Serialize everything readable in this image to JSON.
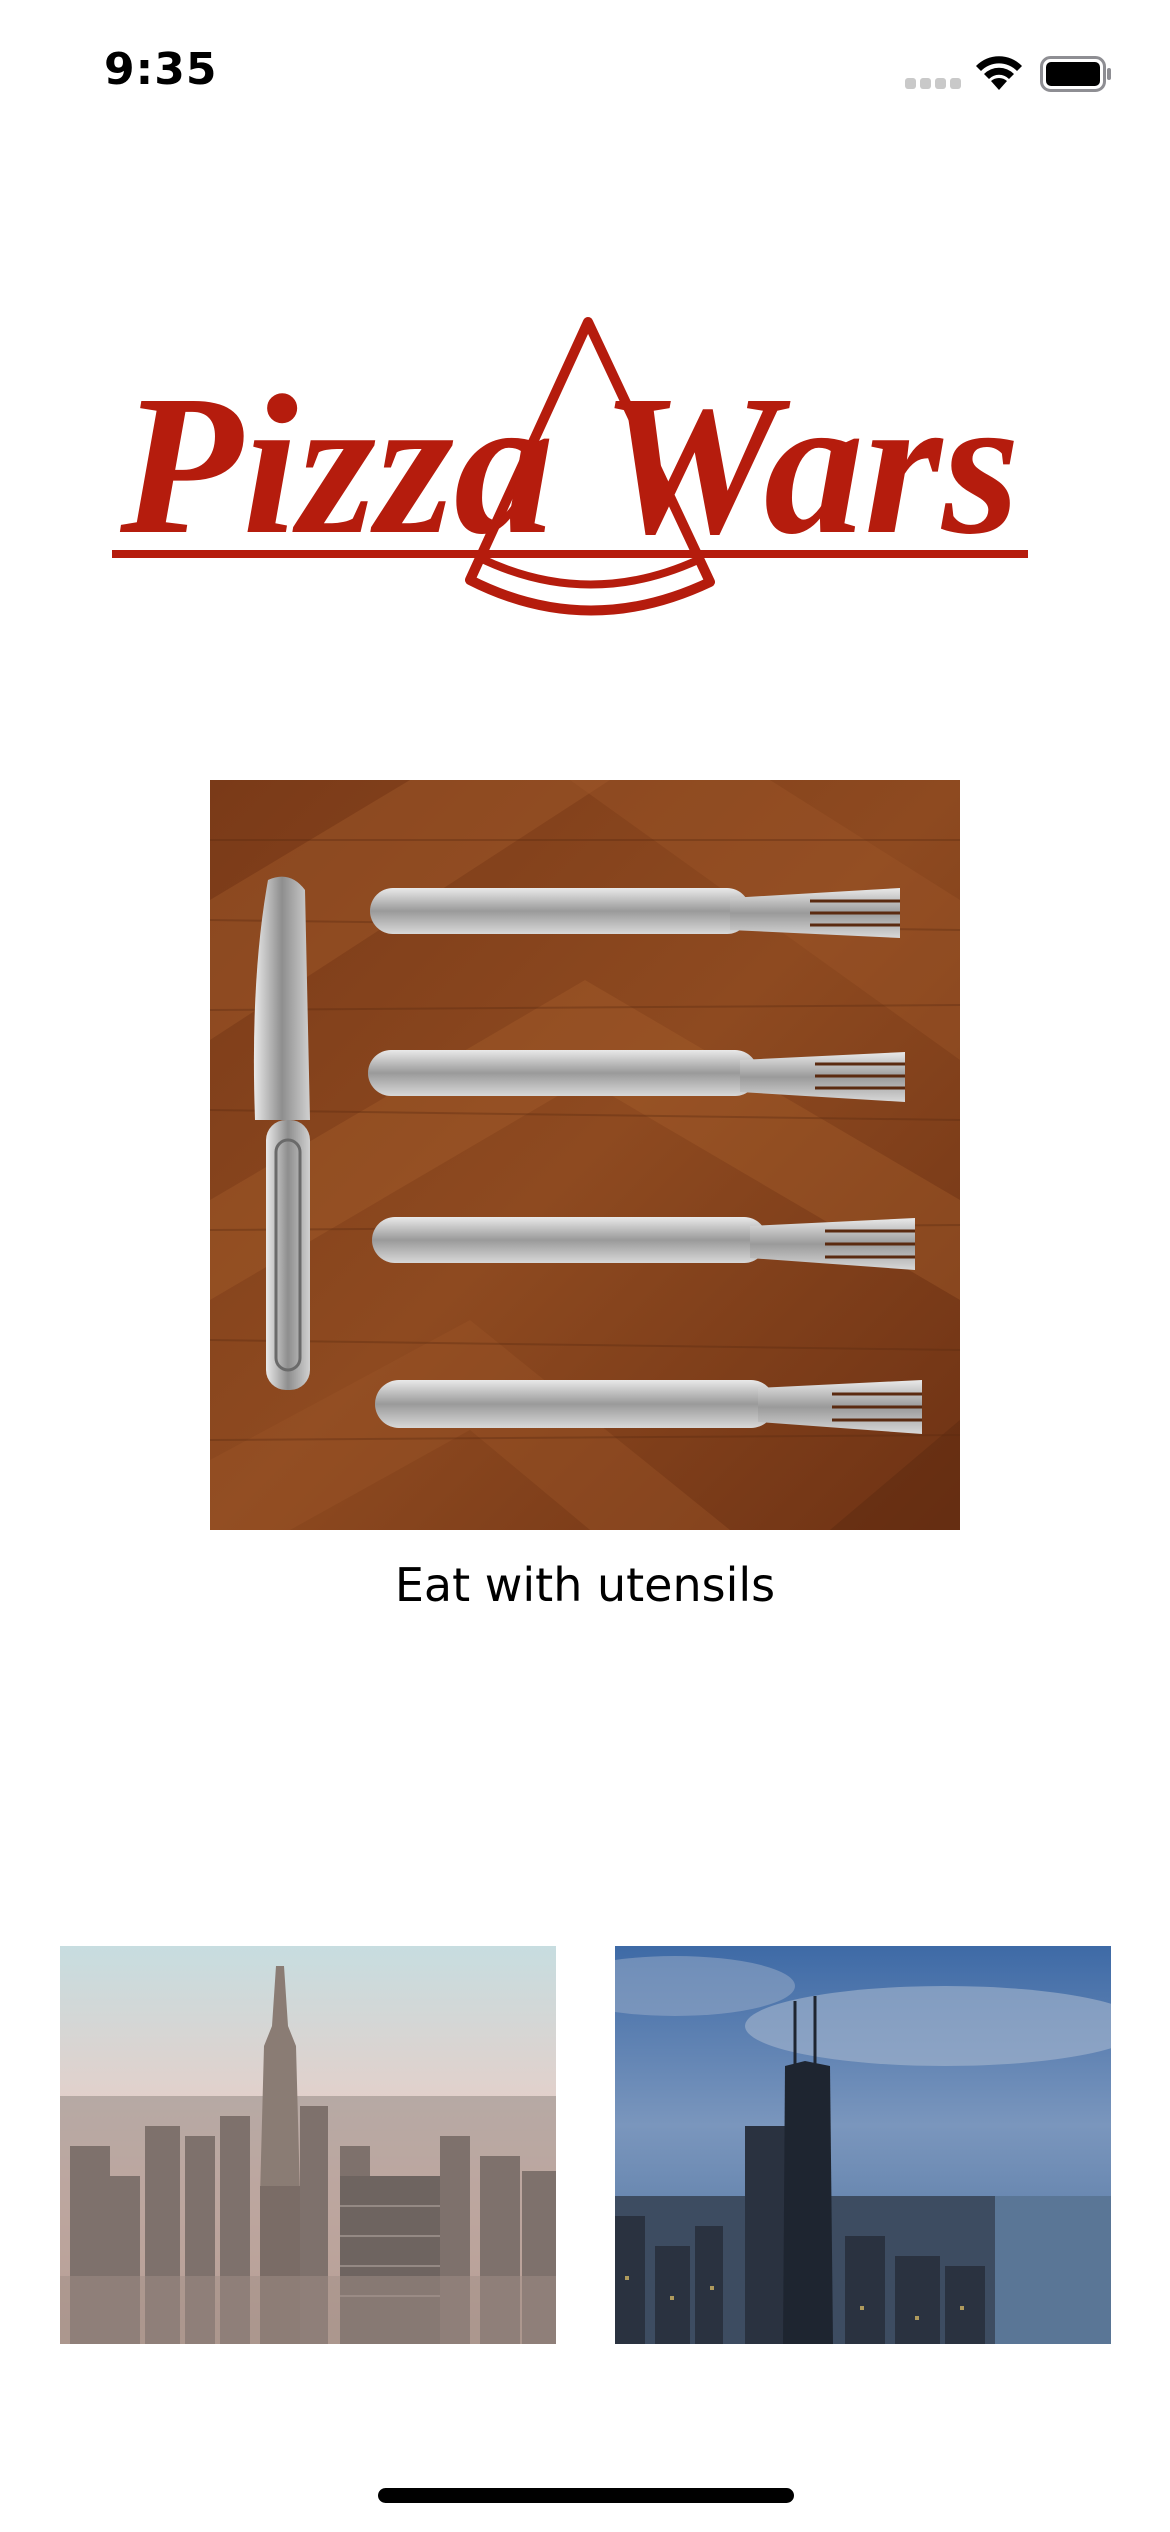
{
  "status_bar": {
    "time": "9:35",
    "icons": [
      "cellular-signal-icon",
      "wifi-icon",
      "battery-icon"
    ]
  },
  "logo": {
    "text": "Pizza Wars",
    "brand_color": "#b51c0d"
  },
  "hero": {
    "image": "cutlery-on-wooden-table-photo",
    "caption": "Eat with utensils"
  },
  "city_photos": [
    {
      "image": "new-york-skyline-photo"
    },
    {
      "image": "chicago-skyline-photo"
    }
  ]
}
